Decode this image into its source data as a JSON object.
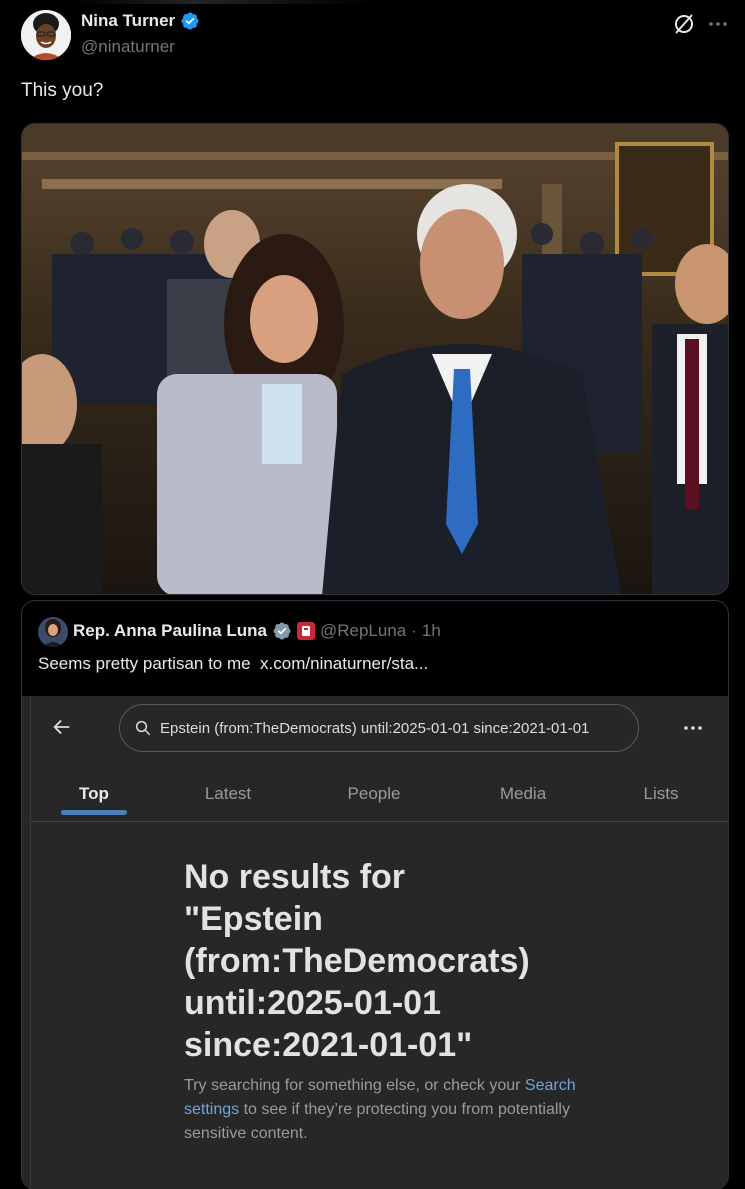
{
  "author": {
    "name": "Nina Turner",
    "handle": "@ninaturner",
    "verified_color": "#1d9bf0"
  },
  "tweet": {
    "text": "This you?"
  },
  "quote": {
    "name": "Rep. Anna Paulina Luna",
    "handle": "@RepLuna",
    "separator": "·",
    "time": "1h",
    "text": "Seems pretty partisan to me",
    "link": "x.com/ninaturner/sta...",
    "embedded": {
      "search_query": "Epstein (from:TheDemocrats) until:2025-01-01 since:2021-01-01",
      "tabs": [
        {
          "label": "Top"
        },
        {
          "label": "Latest"
        },
        {
          "label": "People"
        },
        {
          "label": "Media"
        },
        {
          "label": "Lists"
        }
      ],
      "no_results_lines": [
        "No results for",
        "\"Epstein",
        "(from:TheDemocrats)",
        "until:2025-01-01",
        "since:2021-01-01\""
      ],
      "hint_pre": "Try searching for something else, or check your",
      "hint_link": "Search settings",
      "hint_post": "to see if they’re protecting you from potentially sensitive content."
    }
  },
  "colors": {
    "background": "#000000",
    "text": "#e7e9ea",
    "muted": "#71767b",
    "tab_indicator": "#4a7fb8"
  }
}
